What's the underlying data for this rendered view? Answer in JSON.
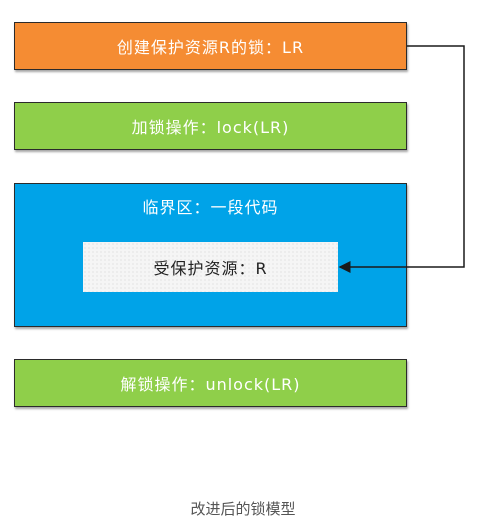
{
  "diagram": {
    "create_label": "创建保护资源R的锁：LR",
    "lock_label": "加锁操作：lock(LR)",
    "critical_label": "临界区：一段代码",
    "resource_label": "受保护资源：R",
    "unlock_label": "解锁操作：unlock(LR)",
    "caption": "改进后的锁模型",
    "colors": {
      "orange": "#f58c33",
      "green": "#8fcf4a",
      "blue": "#00a3e8",
      "border": "#2b2b2b"
    }
  }
}
